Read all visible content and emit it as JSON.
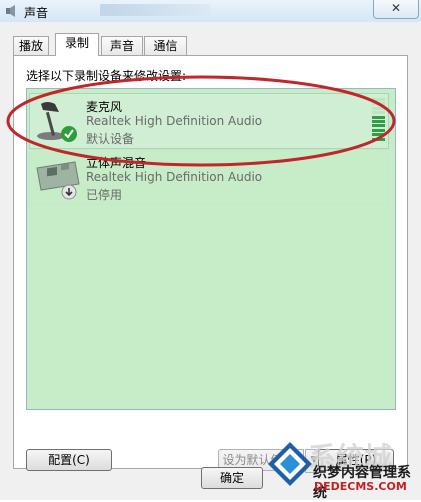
{
  "window": {
    "title": "声音",
    "close_glyph": "✕"
  },
  "tabs": [
    {
      "label": "播放",
      "active": false
    },
    {
      "label": "录制",
      "active": true
    },
    {
      "label": "声音",
      "active": false
    },
    {
      "label": "通信",
      "active": false
    }
  ],
  "instruction": "选择以下录制设备来修改设置:",
  "devices": [
    {
      "name": "麦克风",
      "description": "Realtek High Definition Audio",
      "status": "默认设备",
      "icon": "microphone-icon",
      "badge": "check-icon",
      "selected": true,
      "level_fraction": 0.6
    },
    {
      "name": "立体声混音",
      "description": "Realtek High Definition Audio",
      "status": "已停用",
      "icon": "sound-card-icon",
      "badge": "disabled-arrow-icon",
      "selected": false
    }
  ],
  "buttons": {
    "configure": "配置(C)",
    "set_default": "设为默认值(S)",
    "set_default_arrow": "▼",
    "properties": "属性(P)",
    "ok": "确定"
  },
  "watermark": {
    "main": "织梦内容管理系统",
    "url": "DEDECMS.COM",
    "site": "系统城"
  },
  "colors": {
    "list_background": "#c7ecc8",
    "annotation": "#c0272d",
    "level_on": "#2f9e44",
    "level_off": "#bfe3c4"
  }
}
